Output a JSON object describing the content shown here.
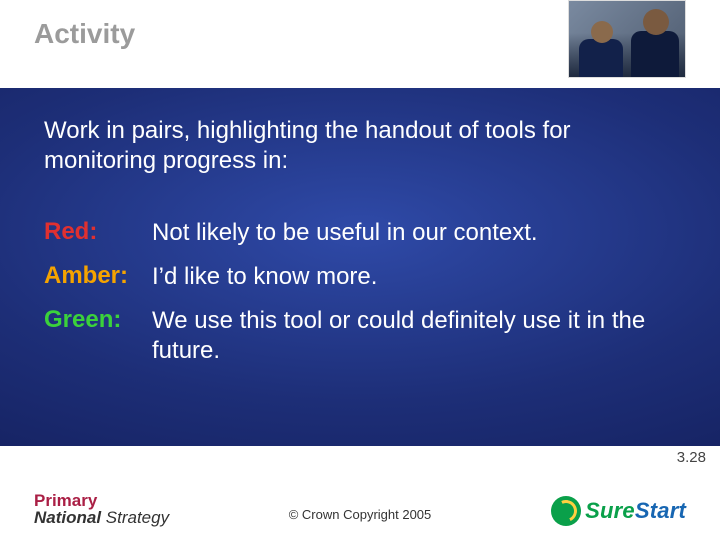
{
  "header": {
    "title": "Activity"
  },
  "body": {
    "intro": "Work in pairs, highlighting the handout of tools for monitoring progress in:",
    "items": [
      {
        "label": "Red:",
        "desc": "Not likely to be useful in our context."
      },
      {
        "label": "Amber:",
        "desc": "I’d like to know more."
      },
      {
        "label": "Green:",
        "desc": "We use this tool or could definitely use it in the future."
      }
    ]
  },
  "footer": {
    "slide_number": "3.28",
    "copyright": "© Crown Copyright 2005",
    "logo_left": {
      "primary": "Primary",
      "national": "National",
      "strategy": " Strategy"
    },
    "logo_right": {
      "sure": "Sure",
      "start": "Start"
    }
  },
  "colors": {
    "red": "#e03030",
    "amber": "#f5a300",
    "green": "#3bd23b"
  }
}
